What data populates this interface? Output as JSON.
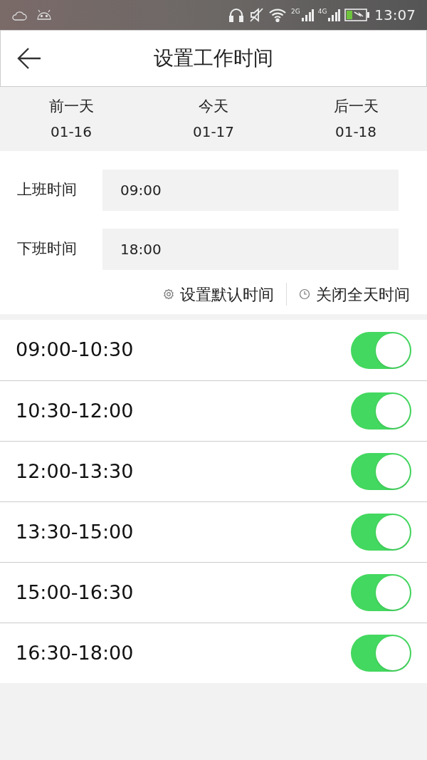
{
  "status_bar": {
    "network_2g": "2G",
    "network_4g": "4G",
    "time": "13:07"
  },
  "header": {
    "title": "设置工作时间"
  },
  "days": [
    {
      "label": "前一天",
      "date": "01-16"
    },
    {
      "label": "今天",
      "date": "01-17"
    },
    {
      "label": "后一天",
      "date": "01-18"
    }
  ],
  "form": {
    "fields": [
      {
        "label": "上班时间",
        "value": "09:00"
      },
      {
        "label": "下班时间",
        "value": "18:00"
      }
    ],
    "actions": [
      {
        "kind": "gear",
        "label": "设置默认时间"
      },
      {
        "kind": "clock",
        "label": "关闭全天时间"
      }
    ]
  },
  "slots": [
    {
      "time": "09:00-10:30",
      "on": true
    },
    {
      "time": "10:30-12:00",
      "on": true
    },
    {
      "time": "12:00-13:30",
      "on": true
    },
    {
      "time": "13:30-15:00",
      "on": true
    },
    {
      "time": "15:00-16:30",
      "on": true
    },
    {
      "time": "16:30-18:00",
      "on": true
    }
  ]
}
